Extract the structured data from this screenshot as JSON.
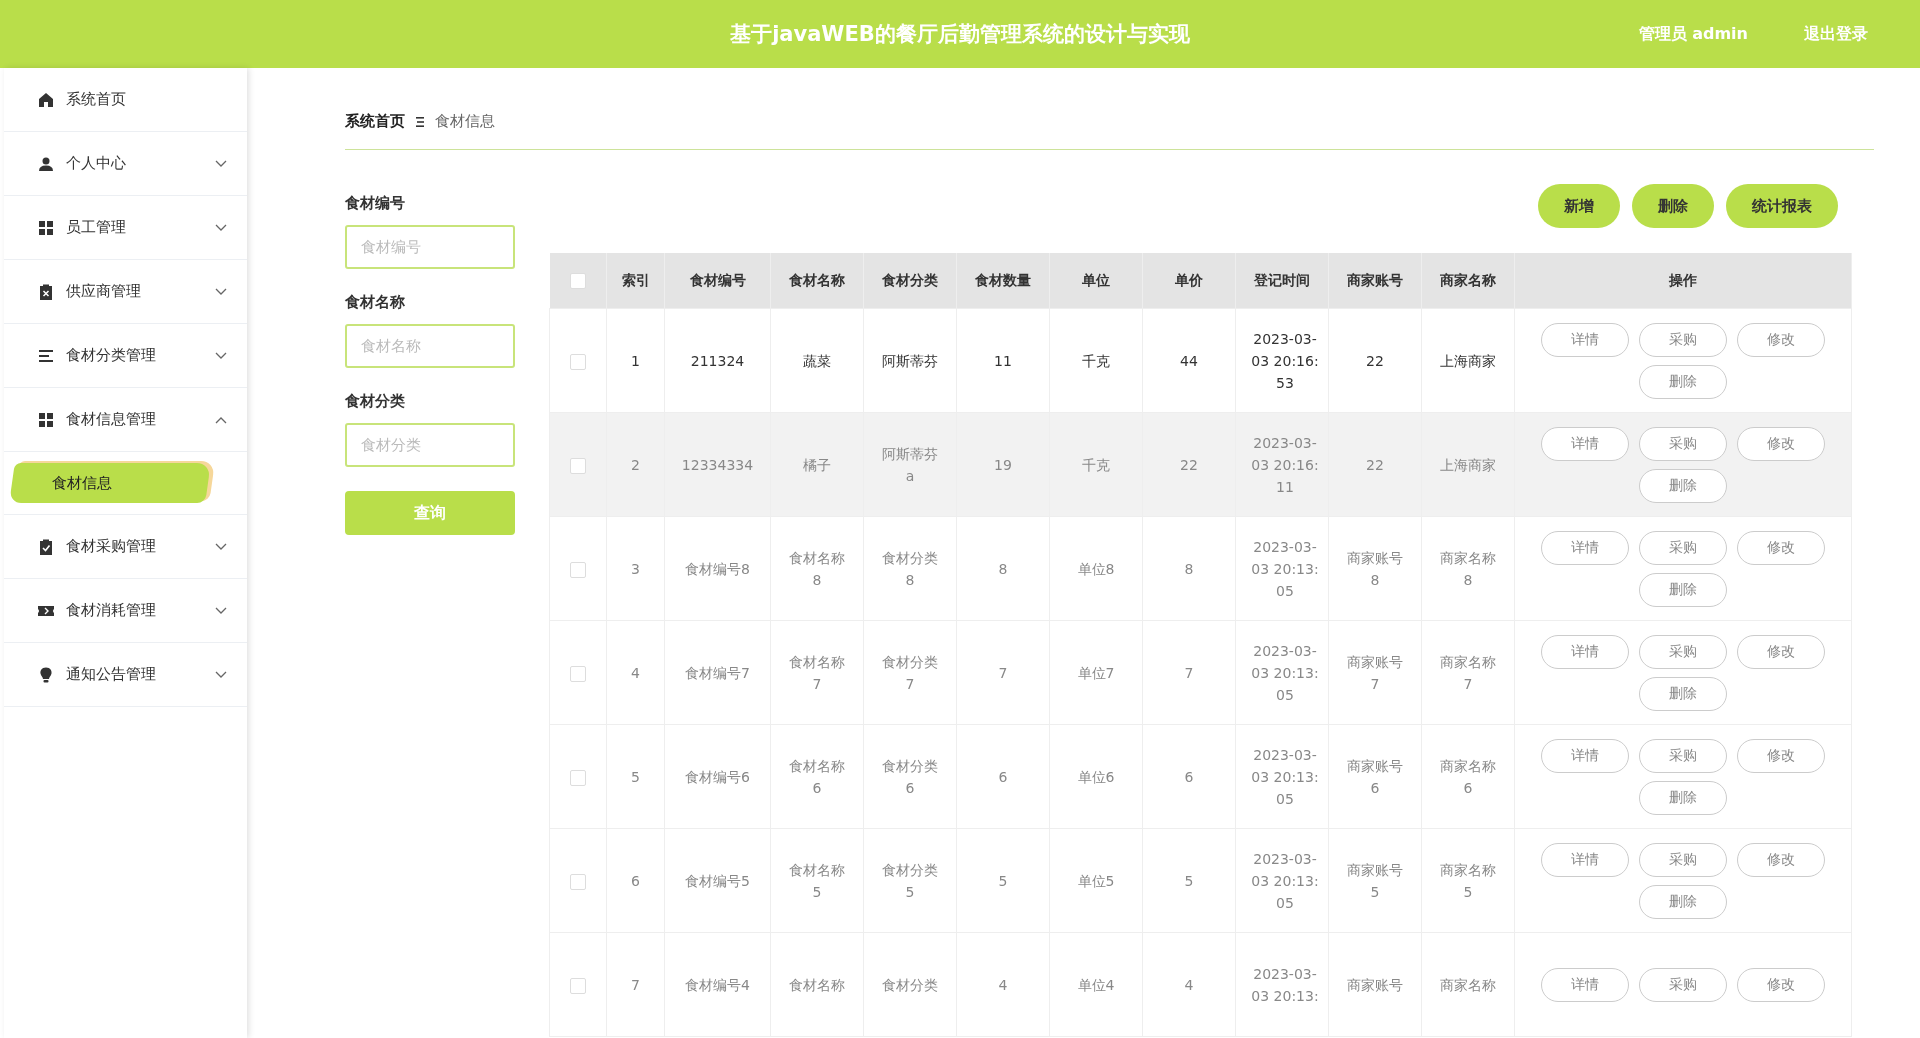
{
  "header": {
    "title": "基于javaWEB的餐厅后勤管理系统的设计与实现",
    "user": "管理员 admin",
    "logout": "退出登录"
  },
  "sidebar": {
    "items": [
      {
        "label": "系统首页",
        "selected": false
      },
      {
        "label": "个人中心",
        "selected": false,
        "expanded": false
      },
      {
        "label": "员工管理",
        "selected": false,
        "expanded": false
      },
      {
        "label": "供应商管理",
        "selected": false,
        "expanded": false
      },
      {
        "label": "食材分类管理",
        "selected": false,
        "expanded": false
      },
      {
        "label": "食材信息管理",
        "selected": false,
        "expanded": true,
        "children": [
          {
            "label": "食材信息",
            "selected": true
          }
        ]
      },
      {
        "label": "食材采购管理",
        "selected": false,
        "expanded": false
      },
      {
        "label": "食材消耗管理",
        "selected": false,
        "expanded": false
      },
      {
        "label": "通知公告管理",
        "selected": false,
        "expanded": false
      }
    ]
  },
  "breadcrumb": [
    "系统首页",
    "食材信息"
  ],
  "search": {
    "fields": [
      {
        "label": "食材编号",
        "placeholder": "食材编号"
      },
      {
        "label": "食材名称",
        "placeholder": "食材名称"
      },
      {
        "label": "食材分类",
        "placeholder": "食材分类"
      }
    ],
    "button": "查询"
  },
  "actions": [
    "新增",
    "删除",
    "统计报表"
  ],
  "table": {
    "all_checked": false,
    "columns": [
      "索引",
      "食材编号",
      "食材名称",
      "食材分类",
      "食材数量",
      "单位",
      "单价",
      "登记时间",
      "商家账号",
      "商家名称",
      "操作"
    ],
    "rows": [
      {
        "checked": false,
        "emphasized": true,
        "hovered": false,
        "cells": [
          "1",
          "211324",
          "蔬菜",
          "阿斯蒂芬",
          "11",
          "千克",
          "44",
          "2023-03-03 20:16:53",
          "22",
          "上海商家"
        ],
        "buttons": [
          "详情",
          "采购",
          "修改",
          "删除"
        ]
      },
      {
        "checked": false,
        "emphasized": false,
        "hovered": true,
        "cells": [
          "2",
          "12334334",
          "橘子",
          "阿斯蒂芬a",
          "19",
          "千克",
          "22",
          "2023-03-03 20:16:11",
          "22",
          "上海商家"
        ],
        "buttons": [
          "详情",
          "采购",
          "修改",
          "删除"
        ]
      },
      {
        "checked": false,
        "emphasized": false,
        "hovered": false,
        "cells": [
          "3",
          "食材编号8",
          "食材名称8",
          "食材分类8",
          "8",
          "单位8",
          "8",
          "2023-03-03 20:13:05",
          "商家账号8",
          "商家名称8"
        ],
        "buttons": [
          "详情",
          "采购",
          "修改",
          "删除"
        ]
      },
      {
        "checked": false,
        "emphasized": false,
        "hovered": false,
        "cells": [
          "4",
          "食材编号7",
          "食材名称7",
          "食材分类7",
          "7",
          "单位7",
          "7",
          "2023-03-03 20:13:05",
          "商家账号7",
          "商家名称7"
        ],
        "buttons": [
          "详情",
          "采购",
          "修改",
          "删除"
        ]
      },
      {
        "checked": false,
        "emphasized": false,
        "hovered": false,
        "cells": [
          "5",
          "食材编号6",
          "食材名称6",
          "食材分类6",
          "6",
          "单位6",
          "6",
          "2023-03-03 20:13:05",
          "商家账号6",
          "商家名称6"
        ],
        "buttons": [
          "详情",
          "采购",
          "修改",
          "删除"
        ]
      },
      {
        "checked": false,
        "emphasized": false,
        "hovered": false,
        "cells": [
          "6",
          "食材编号5",
          "食材名称5",
          "食材分类5",
          "5",
          "单位5",
          "5",
          "2023-03-03 20:13:05",
          "商家账号5",
          "商家名称5"
        ],
        "buttons": [
          "详情",
          "采购",
          "修改",
          "删除"
        ]
      },
      {
        "checked": false,
        "emphasized": false,
        "hovered": false,
        "cells": [
          "7",
          "食材编号4",
          "食材名称",
          "食材分类",
          "4",
          "单位4",
          "4",
          "2023-03-03 20:13:",
          "商家账号",
          "商家名称"
        ],
        "buttons": [
          "详情",
          "采购",
          "修改"
        ]
      }
    ]
  }
}
